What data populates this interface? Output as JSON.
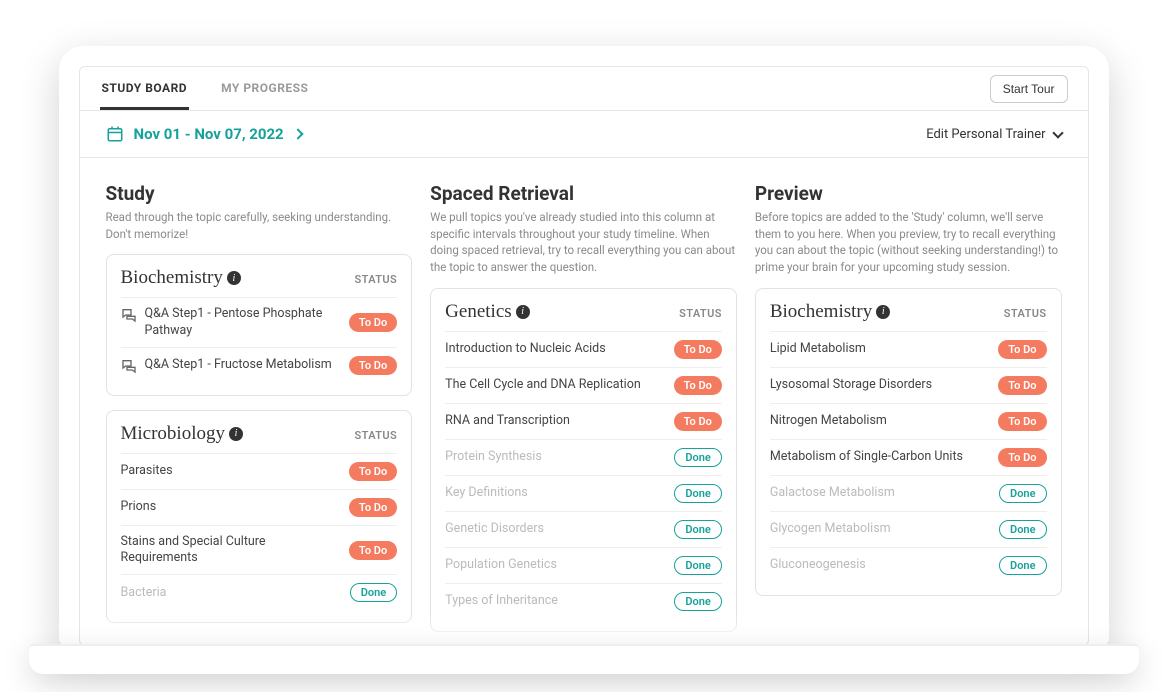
{
  "tabs": {
    "study_board": "STUDY BOARD",
    "my_progress": "MY PROGRESS"
  },
  "header": {
    "start_tour": "Start Tour",
    "date_range": "Nov 01 - Nov 07, 2022",
    "edit_trainer": "Edit Personal Trainer"
  },
  "labels": {
    "status": "STATUS",
    "todo": "To Do",
    "done": "Done"
  },
  "columns": {
    "study": {
      "title": "Study",
      "desc": "Read through the topic carefully, seeking understanding. Don't memorize!",
      "cards": [
        {
          "title": "Biochemistry",
          "topics": [
            {
              "label": "Q&A Step1 - Pentose Phosphate Pathway",
              "status": "todo",
              "icon": true
            },
            {
              "label": "Q&A Step1 - Fructose Metabolism",
              "status": "todo",
              "icon": true
            }
          ]
        },
        {
          "title": "Microbiology",
          "topics": [
            {
              "label": "Parasites",
              "status": "todo"
            },
            {
              "label": "Prions",
              "status": "todo"
            },
            {
              "label": "Stains and Special Culture Requirements",
              "status": "todo"
            },
            {
              "label": "Bacteria",
              "status": "done"
            }
          ]
        }
      ]
    },
    "spaced": {
      "title": "Spaced Retrieval",
      "desc": "We pull topics you've already studied into this column at specific intervals throughout your study timeline. When doing spaced retrieval, try to recall everything you can about the topic to answer the question.",
      "cards": [
        {
          "title": "Genetics",
          "topics": [
            {
              "label": "Introduction to Nucleic Acids",
              "status": "todo"
            },
            {
              "label": "The Cell Cycle and DNA Replication",
              "status": "todo"
            },
            {
              "label": "RNA and Transcription",
              "status": "todo"
            },
            {
              "label": "Protein Synthesis",
              "status": "done"
            },
            {
              "label": "Key Definitions",
              "status": "done"
            },
            {
              "label": "Genetic Disorders",
              "status": "done"
            },
            {
              "label": "Population Genetics",
              "status": "done"
            },
            {
              "label": "Types of Inheritance",
              "status": "done"
            }
          ]
        }
      ]
    },
    "preview": {
      "title": "Preview",
      "desc": "Before topics are added to the 'Study' column, we'll serve them to you here. When you preview, try to recall everything you can about the topic (without seeking understanding!) to prime your brain for your upcoming study session.",
      "cards": [
        {
          "title": "Biochemistry",
          "topics": [
            {
              "label": "Lipid Metabolism",
              "status": "todo"
            },
            {
              "label": "Lysosomal Storage Disorders",
              "status": "todo"
            },
            {
              "label": "Nitrogen Metabolism",
              "status": "todo"
            },
            {
              "label": "Metabolism of Single-Carbon Units",
              "status": "todo"
            },
            {
              "label": "Galactose Metabolism",
              "status": "done"
            },
            {
              "label": "Glycogen Metabolism",
              "status": "done"
            },
            {
              "label": "Gluconeogenesis",
              "status": "done"
            }
          ]
        }
      ]
    }
  }
}
